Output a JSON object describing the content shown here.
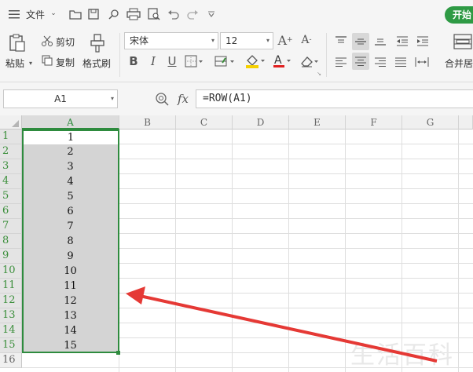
{
  "menu": {
    "file_label": "文件",
    "start_tab": "开始"
  },
  "clipboard": {
    "paste": "粘贴",
    "cut": "剪切",
    "copy": "复制",
    "format_painter": "格式刷"
  },
  "font": {
    "name": "宋体",
    "size": "12"
  },
  "merge": {
    "label": "合并居"
  },
  "formula_bar": {
    "cell_ref": "A1",
    "fx": "fx",
    "formula": "=ROW(A1)"
  },
  "columns": [
    "A",
    "B",
    "C",
    "D",
    "E",
    "F",
    "G"
  ],
  "rows": [
    {
      "num": "1",
      "a": "1"
    },
    {
      "num": "2",
      "a": "2"
    },
    {
      "num": "3",
      "a": "3"
    },
    {
      "num": "4",
      "a": "4"
    },
    {
      "num": "5",
      "a": "5"
    },
    {
      "num": "6",
      "a": "6"
    },
    {
      "num": "7",
      "a": "7"
    },
    {
      "num": "8",
      "a": "8"
    },
    {
      "num": "9",
      "a": "9"
    },
    {
      "num": "10",
      "a": "10"
    },
    {
      "num": "11",
      "a": "11"
    },
    {
      "num": "12",
      "a": "12"
    },
    {
      "num": "13",
      "a": "13"
    },
    {
      "num": "14",
      "a": "14"
    },
    {
      "num": "15",
      "a": "15"
    },
    {
      "num": "16",
      "a": ""
    }
  ],
  "watermark": "生活百科",
  "colors": {
    "selection_border": "#2e8b3e",
    "selection_fill": "#d4d4d4",
    "accent": "#2e9a44",
    "arrow": "#e53935"
  }
}
